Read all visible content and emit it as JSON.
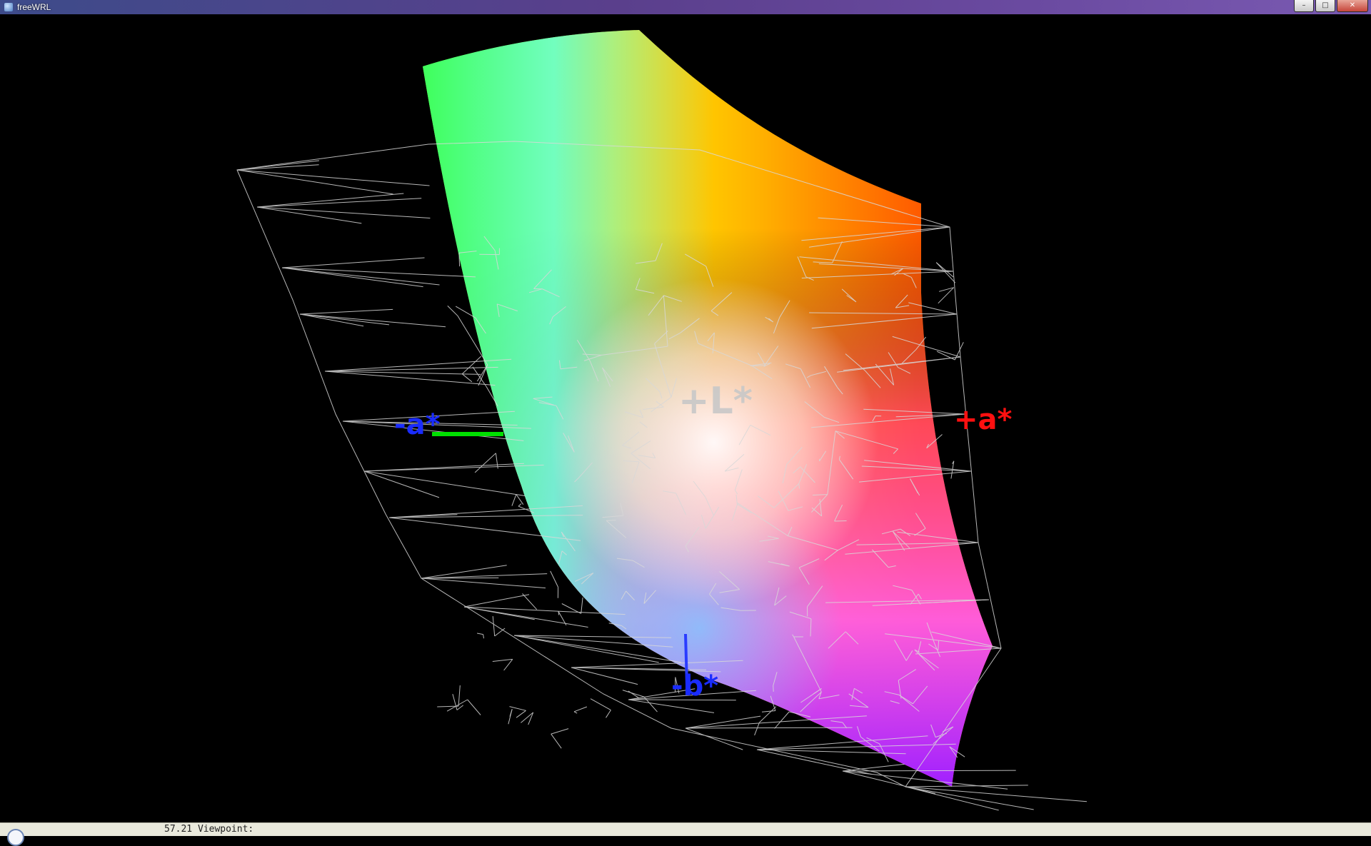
{
  "window": {
    "title": "freeWRL",
    "controls": {
      "minimize": "–",
      "maximize": "□",
      "close": "✕"
    }
  },
  "scene": {
    "labels": {
      "plus_L": "+L*",
      "plus_a": "+a*",
      "minus_a": "-a*",
      "minus_b": "-b*"
    },
    "colors": {
      "background": "#000000",
      "wireframe": "#d8d8d8",
      "label_L": "#c8c8c8",
      "label_plus_a": "#ff1010",
      "label_minus": "#1a2cff",
      "axis_green": "#00e000",
      "axis_blue": "#2a3cff"
    }
  },
  "status": {
    "text": "57.21 Viewpoint:"
  }
}
